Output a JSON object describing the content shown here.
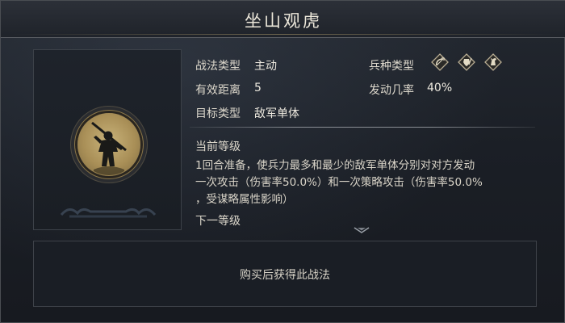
{
  "title": "坐山观虎",
  "info": {
    "type_label": "战法类型",
    "type_value": "主动",
    "range_label": "有效距离",
    "range_value": "5",
    "target_label": "目标类型",
    "target_value": "敌军单体",
    "troop_label": "兵种类型",
    "troop_icons": [
      "bow-icon",
      "shield-icon",
      "horse-icon"
    ],
    "rate_label": "发动几率",
    "rate_value": "40%"
  },
  "current_level": {
    "heading": "当前等级",
    "line1": "1回合准备，使兵力最多和最少的敌军单体分别对对方发动",
    "line2": "一次攻击（伤害率50.0%）和一次策略攻击（伤害率50.0%",
    "line3": "，受谋略属性影响）"
  },
  "next_level": {
    "heading": "下一等级"
  },
  "purchase": {
    "text": "购买后获得此战法"
  },
  "colors": {
    "gold": "#b89a5e",
    "text": "#e6e2d8",
    "panel": "#1b1f26"
  }
}
